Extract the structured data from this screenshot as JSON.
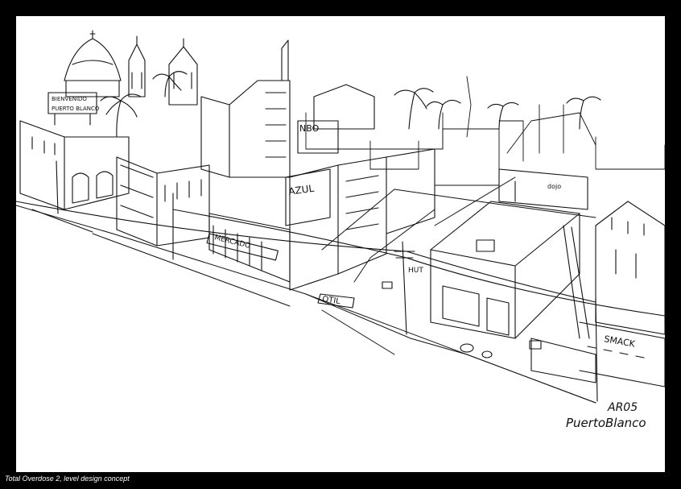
{
  "caption": "Total Overdose 2, level design concept",
  "sketch": {
    "ink_color": "#111111",
    "paper_color": "#ffffff",
    "frame_color": "#000000",
    "signs": {
      "welcome_line1": "BIENVENIDO",
      "welcome_line2": "PUERTO BLANCO",
      "nbo": "NBO",
      "azul": "AZUL",
      "mercado": "MERCADO",
      "lot": "OTIL",
      "hut": "HUT",
      "smack": "SMACK",
      "dojo": "dojo"
    },
    "signature_line1": "AR05",
    "signature_line2": "PuertoBlanco"
  }
}
